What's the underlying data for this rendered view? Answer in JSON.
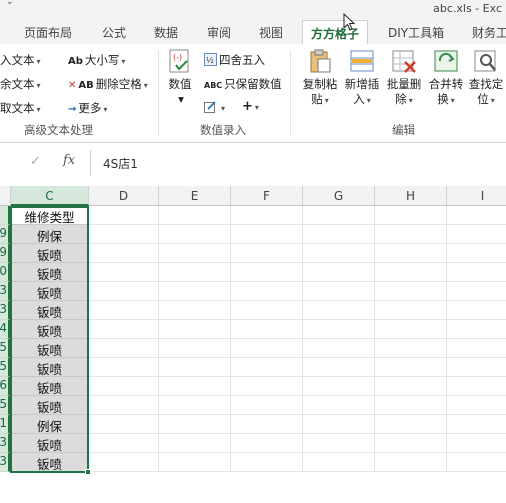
{
  "window": {
    "title": "abc.xls - Exc"
  },
  "tabs": [
    {
      "label": "页面布局"
    },
    {
      "label": "公式"
    },
    {
      "label": "数据"
    },
    {
      "label": "审阅"
    },
    {
      "label": "视图"
    },
    {
      "label": "方方格子",
      "active": true
    },
    {
      "label": "DIY工具箱"
    },
    {
      "label": "财务工"
    }
  ],
  "ribbon": {
    "text_group": {
      "items": [
        {
          "label": "入文本"
        },
        {
          "label": "余文本"
        },
        {
          "label": "取文本"
        },
        {
          "label": "大小写",
          "glyph": "Ab"
        },
        {
          "label": "删除空格",
          "glyph": "AB"
        },
        {
          "label": "更多",
          "glyph": "→"
        }
      ],
      "label": "高级文本处理"
    },
    "number_group": {
      "numeric_label": "数值",
      "round_label": "四舍五入",
      "keep_label": "只保留数值",
      "keep_glyph": "ABC",
      "plus_label": "+",
      "label": "数值录入"
    },
    "edit_group": {
      "buttons": [
        {
          "line1": "复制粘",
          "line2": "贴"
        },
        {
          "line1": "新增插",
          "line2": "入"
        },
        {
          "line1": "批量删",
          "line2": "除"
        },
        {
          "line1": "合并转",
          "line2": "换"
        },
        {
          "line1": "查找定",
          "line2": "位"
        }
      ],
      "label": "编辑"
    }
  },
  "formula_bar": {
    "cancel": "✓",
    "fx": "fx",
    "value": "4S店1"
  },
  "sheet": {
    "columns": [
      "C",
      "D",
      "E",
      "F",
      "G",
      "H",
      "I"
    ],
    "selected_column": "C",
    "row_digits": [
      "",
      "9",
      "9",
      "0",
      "3",
      "3",
      "4",
      "5",
      "5",
      "6",
      "5",
      "1",
      "3",
      "3"
    ],
    "column_c_values": [
      "维修类型",
      "例保",
      "钣喷",
      "钣喷",
      "钣喷",
      "钣喷",
      "钣喷",
      "钣喷",
      "钣喷",
      "钣喷",
      "钣喷",
      "例保",
      "钣喷",
      "钣喷"
    ]
  }
}
